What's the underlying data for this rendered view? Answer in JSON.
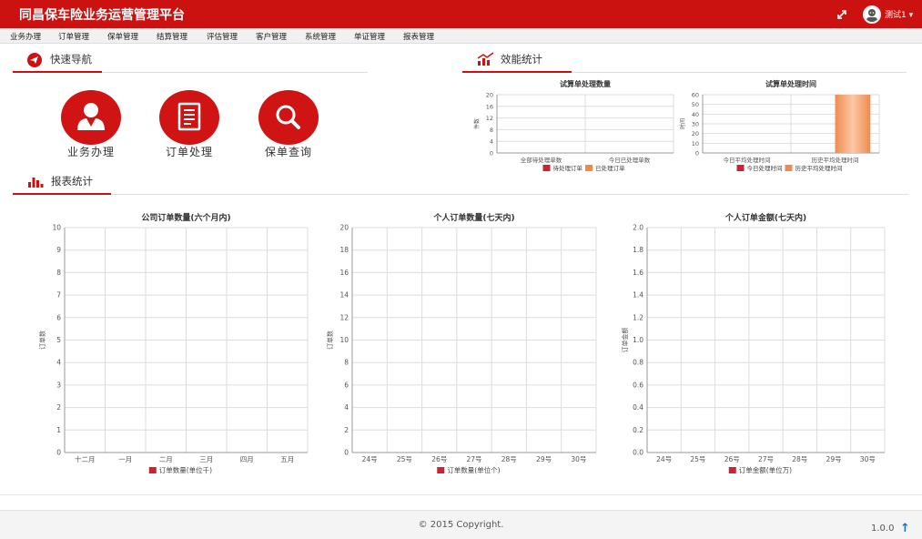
{
  "header": {
    "title": "同昌保车险业务运营管理平台",
    "user": "测试1 ▾"
  },
  "menu": [
    {
      "label": "业务办理"
    },
    {
      "label": "订单管理"
    },
    {
      "label": "保单管理"
    },
    {
      "label": "结算管理"
    },
    {
      "label": "评估管理"
    },
    {
      "label": "客户管理"
    },
    {
      "label": "系统管理"
    },
    {
      "label": "单证管理"
    },
    {
      "label": "报表管理"
    }
  ],
  "sections": {
    "quick_nav": "快速导航",
    "performance": "效能统计",
    "reports": "报表统计"
  },
  "quick_nav": [
    {
      "label": "业务办理",
      "icon": "user-icon"
    },
    {
      "label": "订单处理",
      "icon": "document-icon"
    },
    {
      "label": "保单查询",
      "icon": "search-icon"
    }
  ],
  "footer": {
    "copyright": "© 2015 Copyright.",
    "version": "1.0.0",
    "back_to_top": "↑"
  },
  "colors": {
    "brand": "#cc1111",
    "series_red": "#cc2233",
    "series_orange": "#f0894a"
  },
  "chart_data": [
    {
      "type": "bar",
      "title": "试算单处理数量",
      "ylabel": "件数",
      "categories": [
        "全部待处理单数",
        "今日已处理单数"
      ],
      "ylim": [
        0,
        20
      ],
      "yticks": [
        0,
        4,
        8,
        12,
        16,
        20
      ],
      "series": [
        {
          "name": "待处理订单",
          "color": "#cc2233",
          "values": [
            0,
            0
          ]
        },
        {
          "name": "已处理订单",
          "color": "#f0894a",
          "values": [
            0,
            0
          ]
        }
      ]
    },
    {
      "type": "bar",
      "title": "试算单处理时间",
      "ylabel": "时间",
      "categories": [
        "今日平均处理时间",
        "历史平均处理时间"
      ],
      "ylim": [
        0,
        60
      ],
      "yticks": [
        0,
        10,
        20,
        30,
        40,
        50,
        60
      ],
      "series": [
        {
          "name": "今日处理时间",
          "color": "#cc2233",
          "values": [
            0,
            0
          ]
        },
        {
          "name": "历史平均处理时间",
          "color": "#f0894a",
          "values": [
            0,
            60
          ]
        }
      ]
    },
    {
      "type": "bar",
      "title": "公司订单数量(六个月内)",
      "ylabel": "订单数",
      "categories": [
        "十二月",
        "一月",
        "二月",
        "三月",
        "四月",
        "五月"
      ],
      "ylim": [
        0,
        10
      ],
      "yticks": [
        0,
        1,
        2,
        3,
        4,
        5,
        6,
        7,
        8,
        9,
        10
      ],
      "series": [
        {
          "name": "订单数量(单位千)",
          "color": "#cc2233",
          "values": [
            0,
            0,
            0,
            0,
            0,
            0
          ]
        }
      ]
    },
    {
      "type": "bar",
      "title": "个人订单数量(七天内)",
      "ylabel": "订单数",
      "categories": [
        "24号",
        "25号",
        "26号",
        "27号",
        "28号",
        "29号",
        "30号"
      ],
      "ylim": [
        0,
        20
      ],
      "yticks": [
        0,
        2,
        4,
        6,
        8,
        10,
        12,
        14,
        16,
        18,
        20
      ],
      "series": [
        {
          "name": "订单数量(单位个)",
          "color": "#cc2233",
          "values": [
            0,
            0,
            0,
            0,
            0,
            0,
            0
          ]
        }
      ]
    },
    {
      "type": "bar",
      "title": "个人订单金额(七天内)",
      "ylabel": "订单金额",
      "categories": [
        "24号",
        "25号",
        "26号",
        "27号",
        "28号",
        "29号",
        "30号"
      ],
      "ylim": [
        0,
        2
      ],
      "yticks": [
        "0.0",
        "0.2",
        "0.4",
        "0.6",
        "0.8",
        "1.0",
        "1.2",
        "1.4",
        "1.6",
        "1.8",
        "2.0"
      ],
      "series": [
        {
          "name": "订单金额(单位万)",
          "color": "#cc2233",
          "values": [
            0,
            0,
            0,
            0,
            0,
            0,
            0
          ]
        }
      ]
    }
  ]
}
